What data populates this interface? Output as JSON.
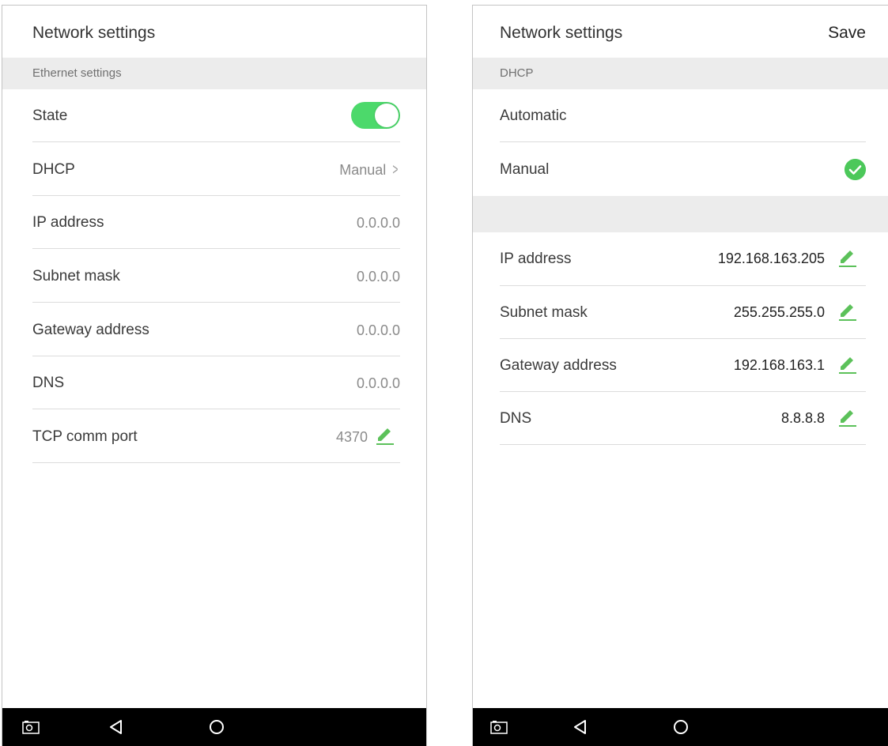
{
  "left_screen": {
    "title": "Network settings",
    "section_label": "Ethernet settings",
    "rows": [
      {
        "label": "State",
        "toggle_on": true
      },
      {
        "label": "DHCP",
        "value": "Manual"
      },
      {
        "label": "IP address",
        "value": "0.0.0.0"
      },
      {
        "label": "Subnet mask",
        "value": "0.0.0.0"
      },
      {
        "label": "Gateway address",
        "value": "0.0.0.0"
      },
      {
        "label": "DNS",
        "value": "0.0.0.0"
      },
      {
        "label": "TCP comm port",
        "value": "4370"
      }
    ]
  },
  "right_screen": {
    "title": "Network settings",
    "save_label": "Save",
    "section_label": "DHCP",
    "options": [
      {
        "label": "Automatic",
        "selected": false
      },
      {
        "label": "Manual",
        "selected": true
      }
    ],
    "fields": [
      {
        "label": "IP address",
        "value": "192.168.163.205"
      },
      {
        "label": "Subnet mask",
        "value": "255.255.255.0"
      },
      {
        "label": "Gateway address",
        "value": "192.168.163.1"
      },
      {
        "label": "DNS",
        "value": "8.8.8.8"
      }
    ]
  },
  "colors": {
    "accent_green": "#4cd96b",
    "check_green": "#4cc85a",
    "pencil_green": "#5cc15a",
    "section_bg": "#ececec"
  },
  "icons": {
    "edit": "pencil-icon",
    "selected": "check-circle-icon",
    "nav": [
      "screenshot-icon",
      "back-icon",
      "home-icon"
    ]
  }
}
